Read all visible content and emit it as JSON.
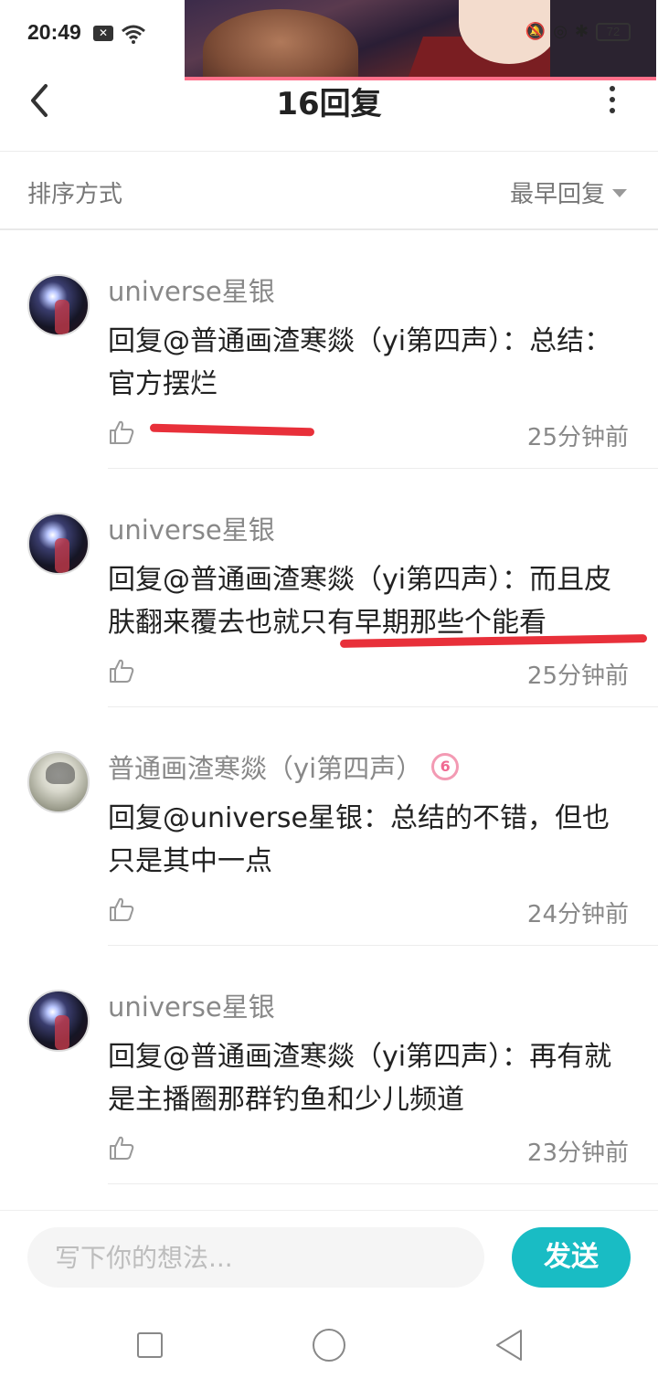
{
  "status_bar": {
    "time": "20:49",
    "battery": "72"
  },
  "header": {
    "title": "16回复"
  },
  "sort": {
    "label": "排序方式",
    "selected": "最早回复"
  },
  "comments": [
    {
      "username": "universe星银",
      "content": "回复@普通画渣寒燚（yi第四声）：总结：官方摆烂",
      "time": "25分钟前"
    },
    {
      "username": "universe星银",
      "content": "回复@普通画渣寒燚（yi第四声）：而且皮肤翻来覆去也就只有早期那些个能看",
      "time": "25分钟前"
    },
    {
      "username": "普通画渣寒燚（yi第四声）",
      "badge": "6",
      "content": "回复@universe星银：总结的不错，但也只是其中一点",
      "time": "24分钟前"
    },
    {
      "username": "universe星银",
      "content": "回复@普通画渣寒燚（yi第四声）：再有就是主播圈那群钓鱼和少儿频道",
      "time": "23分钟前"
    }
  ],
  "input": {
    "placeholder": "写下你的想法..."
  },
  "send_button": "发送",
  "colors": {
    "accent": "#19bcc4",
    "annotation_red": "#e8303a",
    "badge_pink": "#f06a92"
  }
}
